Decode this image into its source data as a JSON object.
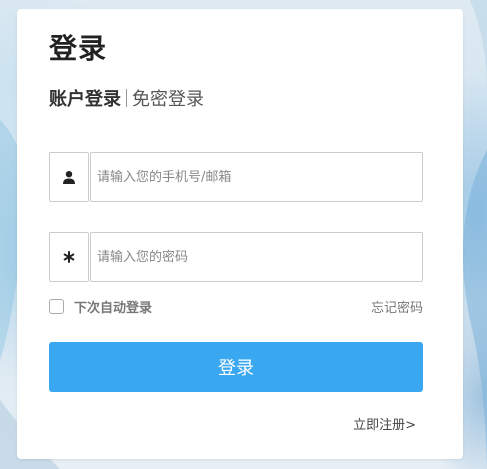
{
  "login": {
    "title": "登录",
    "tabs": {
      "account": "账户登录",
      "passwordless": "免密登录"
    },
    "username": {
      "placeholder": "请输入您的手机号/邮箱",
      "value": "",
      "icon": "user-icon"
    },
    "password": {
      "placeholder": "请输入您的密码",
      "value": "",
      "icon": "asterisk-icon"
    },
    "remember_label": "下次自动登录",
    "remember_checked": false,
    "forgot_label": "忘记密码",
    "submit_label": "登录",
    "register_label": "立即注册>"
  },
  "colors": {
    "primary_button": "#3aa8f0",
    "card_background": "#ffffff",
    "title_text": "#222222",
    "muted_text": "#777777"
  }
}
